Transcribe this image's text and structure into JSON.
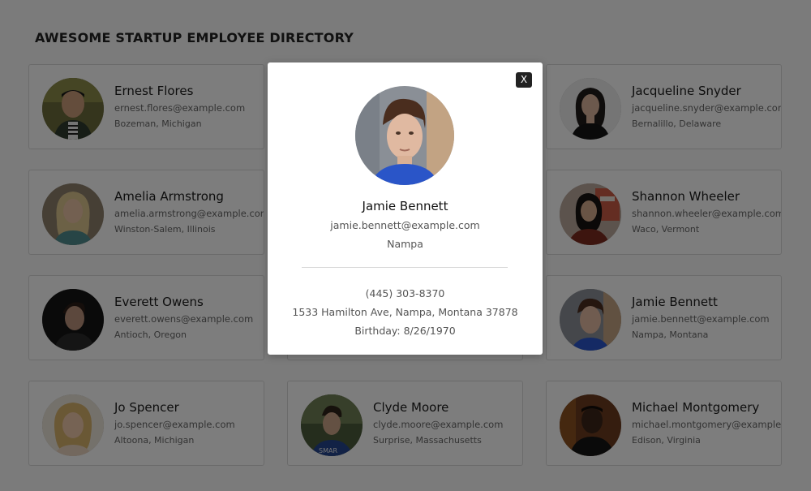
{
  "header": {
    "title": "AWESOME STARTUP EMPLOYEE DIRECTORY"
  },
  "employees": [
    {
      "name": "Ernest Flores",
      "email": "ernest.flores@example.com",
      "location": "Bozeman, Michigan"
    },
    {
      "name": "",
      "email": "",
      "location": ""
    },
    {
      "name": "Jacqueline Snyder",
      "email": "jacqueline.snyder@example.com",
      "location": "Bernalillo, Delaware"
    },
    {
      "name": "Amelia Armstrong",
      "email": "amelia.armstrong@example.com",
      "location": "Winston-Salem, Illinois"
    },
    {
      "name": "",
      "email": "",
      "location": ""
    },
    {
      "name": "Shannon Wheeler",
      "email": "shannon.wheeler@example.com",
      "location": "Waco, Vermont"
    },
    {
      "name": "Everett Owens",
      "email": "everett.owens@example.com",
      "location": "Antioch, Oregon"
    },
    {
      "name": "",
      "email": "",
      "location": ""
    },
    {
      "name": "Jamie Bennett",
      "email": "jamie.bennett@example.com",
      "location": "Nampa, Montana"
    },
    {
      "name": "Jo Spencer",
      "email": "jo.spencer@example.com",
      "location": "Altoona, Michigan"
    },
    {
      "name": "Clyde Moore",
      "email": "clyde.moore@example.com",
      "location": "Surprise, Massachusetts"
    },
    {
      "name": "Michael Montgomery",
      "email": "michael.montgomery@example.com",
      "location": "Edison, Virginia"
    }
  ],
  "modal": {
    "close_label": "X",
    "name": "Jamie Bennett",
    "email": "jamie.bennett@example.com",
    "city": "Nampa",
    "phone": "(445) 303-8370",
    "address": "1533 Hamilton Ave, Nampa, Montana 37878",
    "birthday": "Birthday: 8/26/1970"
  },
  "colors": {
    "overlay": "rgba(0,0,0,0.5)",
    "page_background": "#f7f7f7",
    "close_button": "#222222"
  }
}
